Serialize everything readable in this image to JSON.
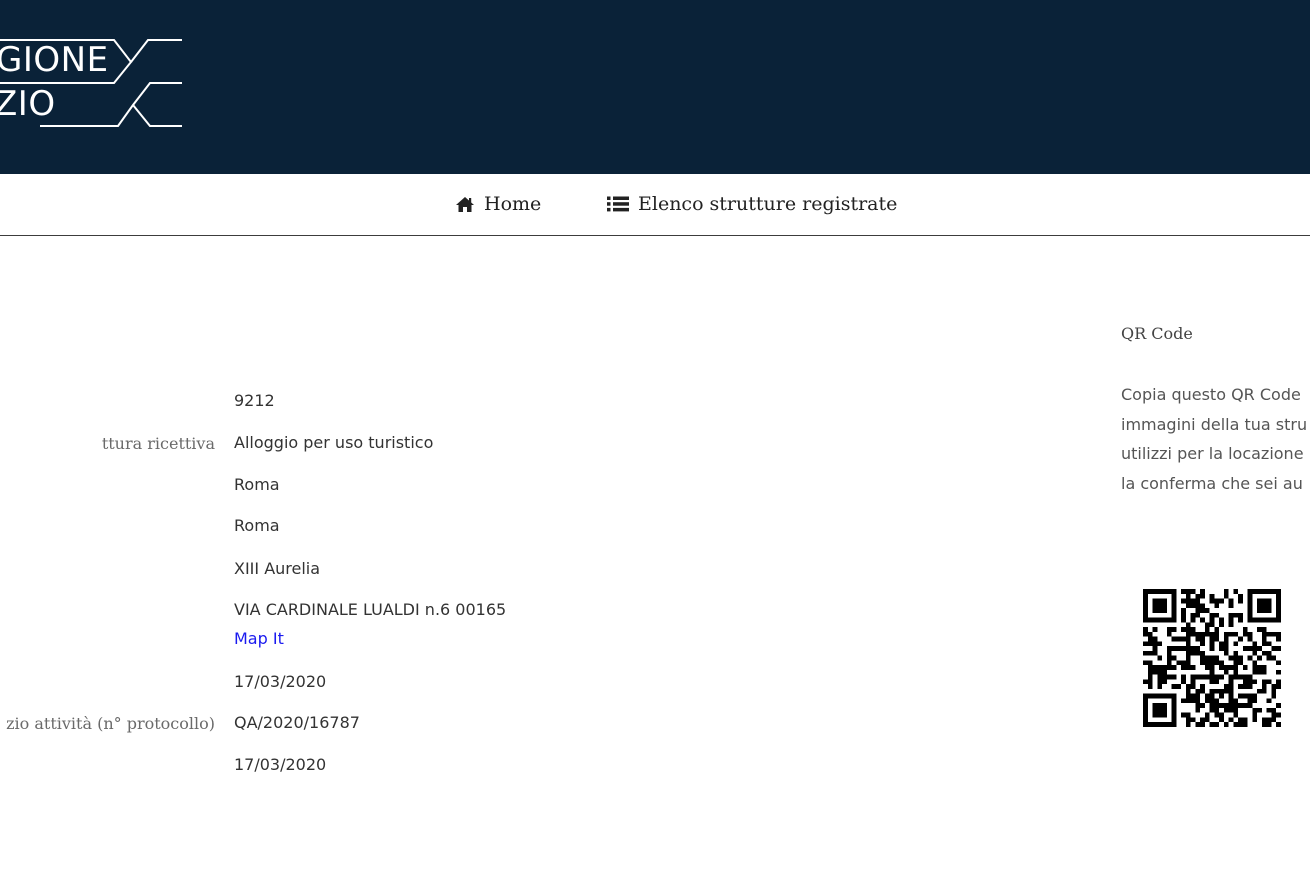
{
  "header": {
    "logo_line1": "GIONE",
    "logo_line2": "ZIO"
  },
  "nav": {
    "home_label": "Home",
    "home_icon": "home-icon",
    "list_label": "Elenco strutture registrate",
    "list_icon": "list-icon"
  },
  "details": [
    {
      "label": "",
      "value": "9212"
    },
    {
      "label": "ttura ricettiva",
      "value": "Alloggio per uso turistico"
    },
    {
      "label": "",
      "value": "Roma"
    },
    {
      "label": "",
      "value": "Roma"
    },
    {
      "label": "",
      "value": "XIII Aurelia"
    },
    {
      "label": "",
      "value": "VIA CARDINALE LUALDI n.6 00165",
      "link": "Map It"
    },
    {
      "label": "",
      "value": "17/03/2020"
    },
    {
      "label": "zio attività (n° protocollo)",
      "value": "QA/2020/16787"
    },
    {
      "label": "",
      "value": "17/03/2020"
    }
  ],
  "qr": {
    "title": "QR Code",
    "description_lines": [
      "Copia questo QR Code",
      "immagini della tua stru",
      "utilizzi per la locazione",
      "la conferma che sei au"
    ]
  },
  "colors": {
    "header_bg": "#0a2238",
    "link": "#1a1aef"
  }
}
